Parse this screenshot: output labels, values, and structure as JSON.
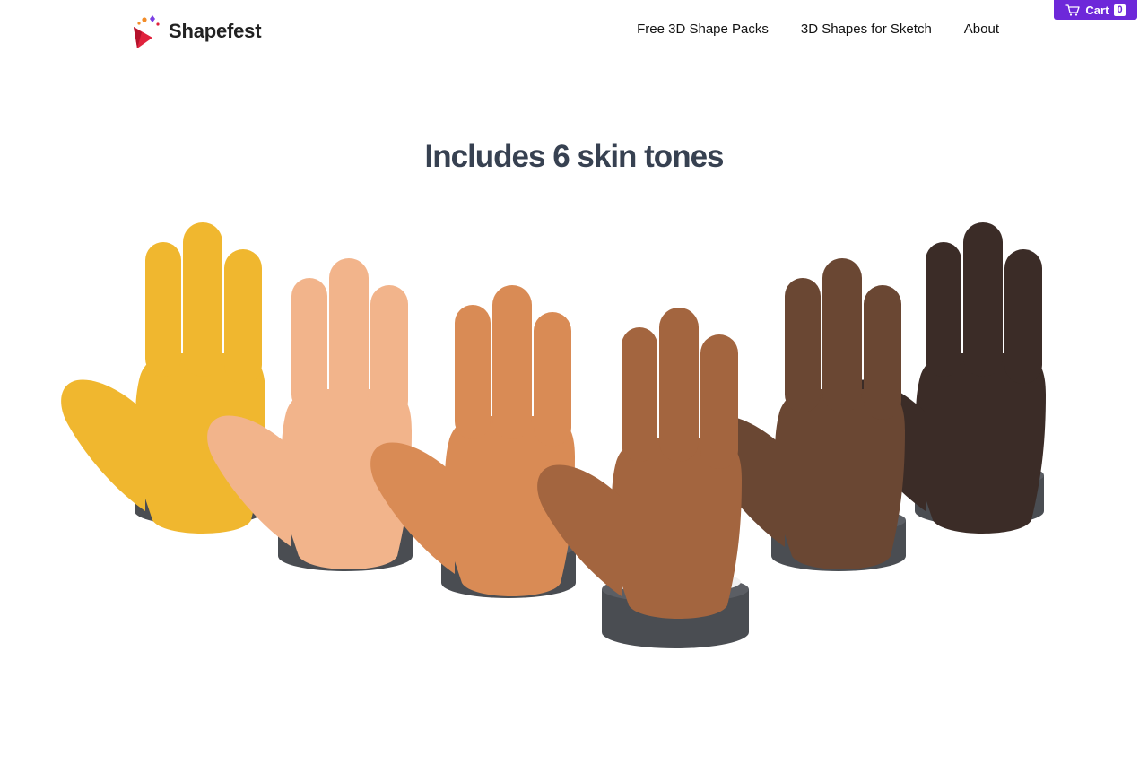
{
  "brand": {
    "name": "Shapefest",
    "logo_icon": "shapefest-logo-icon",
    "colors": {
      "triangle": "#e0223d",
      "dot_orange": "#f28c28",
      "dot_purple": "#7b3fe4",
      "dot_red": "#e0223d"
    }
  },
  "nav": {
    "items": [
      {
        "label": "Free 3D Shape Packs"
      },
      {
        "label": "3D Shapes for Sketch"
      },
      {
        "label": "About"
      }
    ]
  },
  "cart": {
    "label": "Cart",
    "count": "0",
    "icon": "cart-icon",
    "color": "#6d28d9"
  },
  "main": {
    "heading": "Includes 6 skin tones"
  },
  "hands": [
    {
      "name": "yellow",
      "color": "#F0B72F"
    },
    {
      "name": "light",
      "color": "#F2B48B"
    },
    {
      "name": "medium-light",
      "color": "#D98B55"
    },
    {
      "name": "medium",
      "color": "#A3653F"
    },
    {
      "name": "medium-dark",
      "color": "#6A4733"
    },
    {
      "name": "dark",
      "color": "#3B2C27"
    }
  ],
  "cuff": {
    "band_color": "#f1f1f1",
    "sleeve_color": "#4a4d52"
  }
}
